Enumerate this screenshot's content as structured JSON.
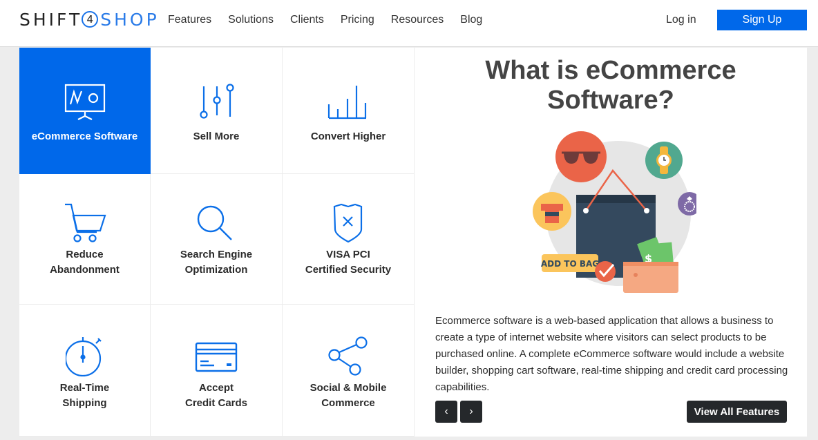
{
  "header": {
    "logo": {
      "part1": "SHIFT",
      "number": "4",
      "part2": "SHOP"
    },
    "nav": [
      "Features",
      "Solutions",
      "Clients",
      "Pricing",
      "Resources",
      "Blog"
    ],
    "login_label": "Log in",
    "signup_label": "Sign Up"
  },
  "features": [
    {
      "label_line1": "eCommerce Software",
      "label_line2": "",
      "icon": "presentation-board-icon",
      "active": true
    },
    {
      "label_line1": "Sell More",
      "label_line2": "",
      "icon": "sliders-icon",
      "active": false
    },
    {
      "label_line1": "Convert Higher",
      "label_line2": "",
      "icon": "bar-chart-icon",
      "active": false
    },
    {
      "label_line1": "Reduce",
      "label_line2": "Abandonment",
      "icon": "shopping-cart-icon",
      "active": false
    },
    {
      "label_line1": "Search Engine",
      "label_line2": "Optimization",
      "icon": "magnifier-icon",
      "active": false
    },
    {
      "label_line1": "VISA PCI",
      "label_line2": "Certified Security",
      "icon": "shield-icon",
      "active": false
    },
    {
      "label_line1": "Real-Time",
      "label_line2": "Shipping",
      "icon": "stopwatch-icon",
      "active": false
    },
    {
      "label_line1": "Accept",
      "label_line2": "Credit Cards",
      "icon": "credit-card-icon",
      "active": false
    },
    {
      "label_line1": "Social & Mobile",
      "label_line2": "Commerce",
      "icon": "share-icon",
      "active": false
    }
  ],
  "detail": {
    "title_line1": "What is eCommerce",
    "title_line2": "Software?",
    "illustration_badge": "ADD TO BAG",
    "description": "Ecommerce software is a web-based application that allows a business to create a type of internet website where visitors can select products to be purchased online. A complete eCommerce software would include a website builder, shopping cart software, real-time shipping and credit card processing capabilities.",
    "prev_label": "‹",
    "next_label": "›",
    "view_all_label": "View All Features"
  },
  "colors": {
    "brand_blue": "#0068ea",
    "dark_button": "#25282b",
    "page_bg": "#ededed"
  }
}
